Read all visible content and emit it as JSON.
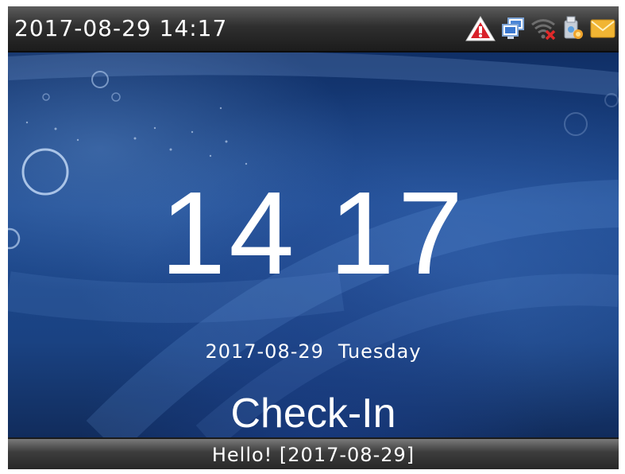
{
  "status_bar": {
    "datetime": "2017-08-29 14:17",
    "icons": [
      "alarm-warning-icon",
      "network-computer-icon",
      "wifi-disconnected-icon",
      "usb-device-icon",
      "message-envelope-icon"
    ]
  },
  "main": {
    "clock_hour": "14",
    "clock_minute": "17",
    "date": "2017-08-29",
    "weekday": "Tuesday",
    "state": "Check-In"
  },
  "message_bar": {
    "text": "Hello! [2017-08-29]"
  },
  "colors": {
    "background_blue": "#1b3f7a",
    "bar_dark": "#2f2f2f",
    "alert_red": "#d9212a",
    "envelope_yellow": "#f1b533"
  }
}
